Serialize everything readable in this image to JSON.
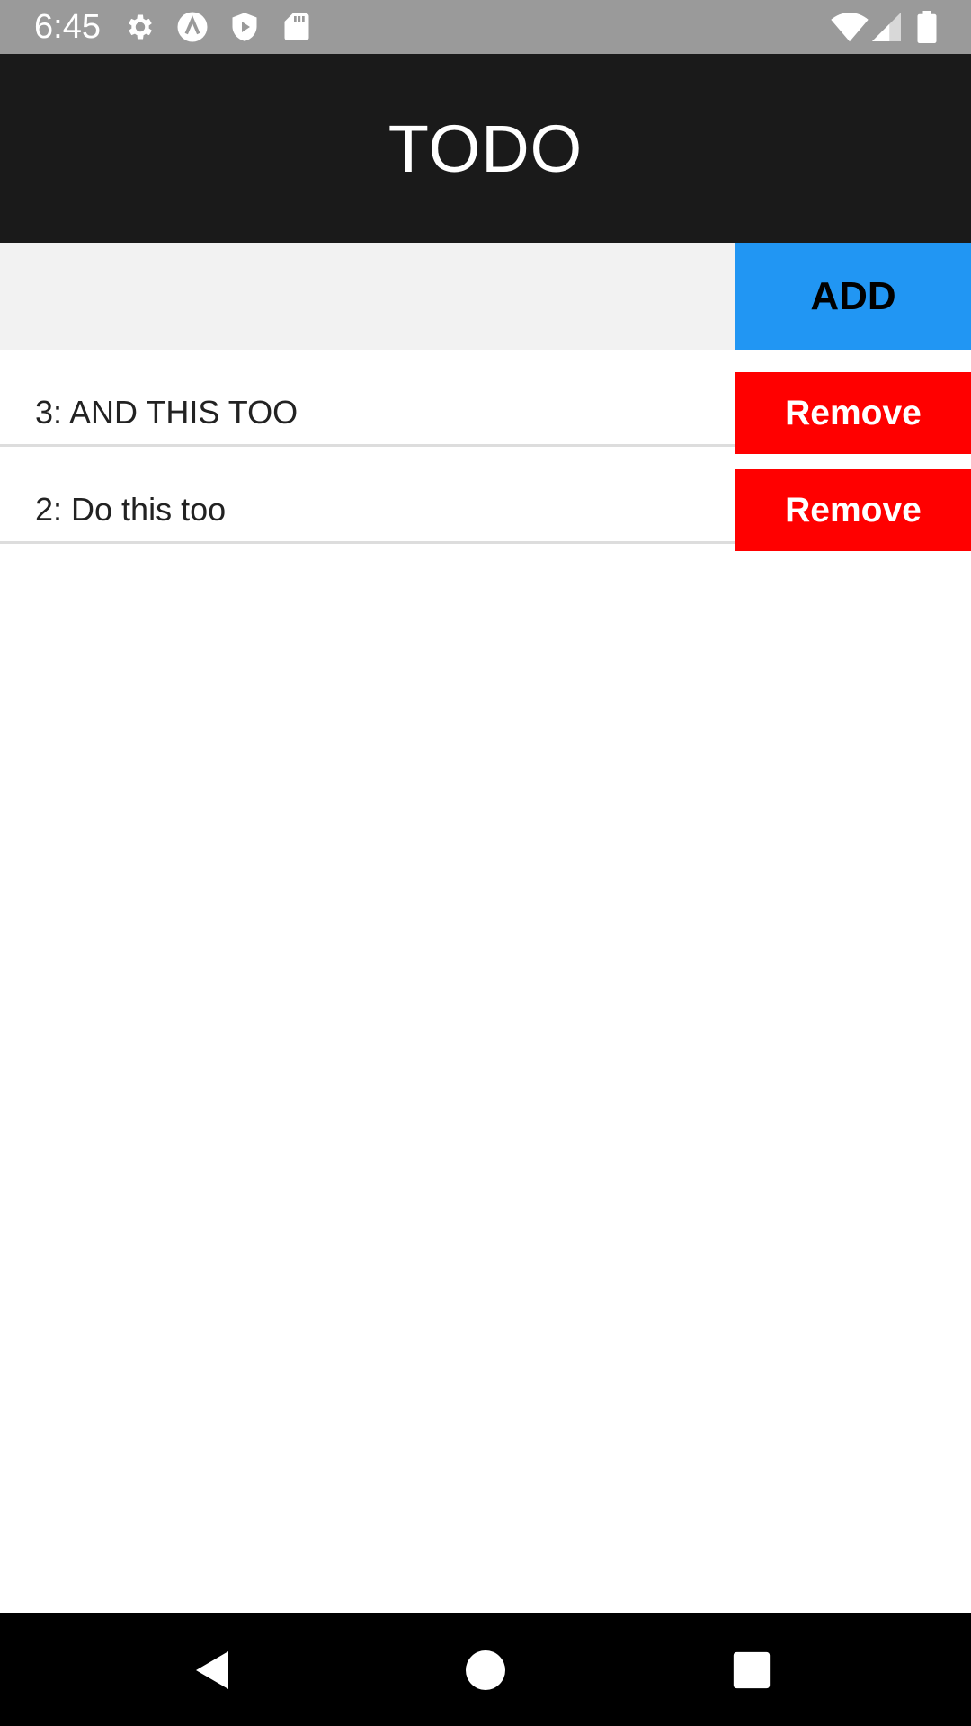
{
  "status_bar": {
    "time": "6:45",
    "icons": [
      "gear-icon",
      "a-circle-icon",
      "shield-play-icon",
      "sd-card-icon",
      "wifi-icon",
      "signal-icon",
      "battery-icon"
    ]
  },
  "app_bar": {
    "title": "TODO"
  },
  "input": {
    "value": "",
    "placeholder": ""
  },
  "add_button": {
    "label": "ADD"
  },
  "todos": [
    {
      "text": "3: AND THIS TOO",
      "remove_label": "Remove"
    },
    {
      "text": "2: Do this too",
      "remove_label": "Remove"
    }
  ],
  "nav_bar": {
    "icons": [
      "back-icon",
      "home-icon",
      "recents-icon"
    ]
  },
  "colors": {
    "status_bar": "#9a9a9a",
    "app_bar": "#1a1a1a",
    "add_button": "#2196f3",
    "remove_button": "#ff0000",
    "input_bg": "#f2f2f2",
    "nav_bar": "#000000"
  }
}
